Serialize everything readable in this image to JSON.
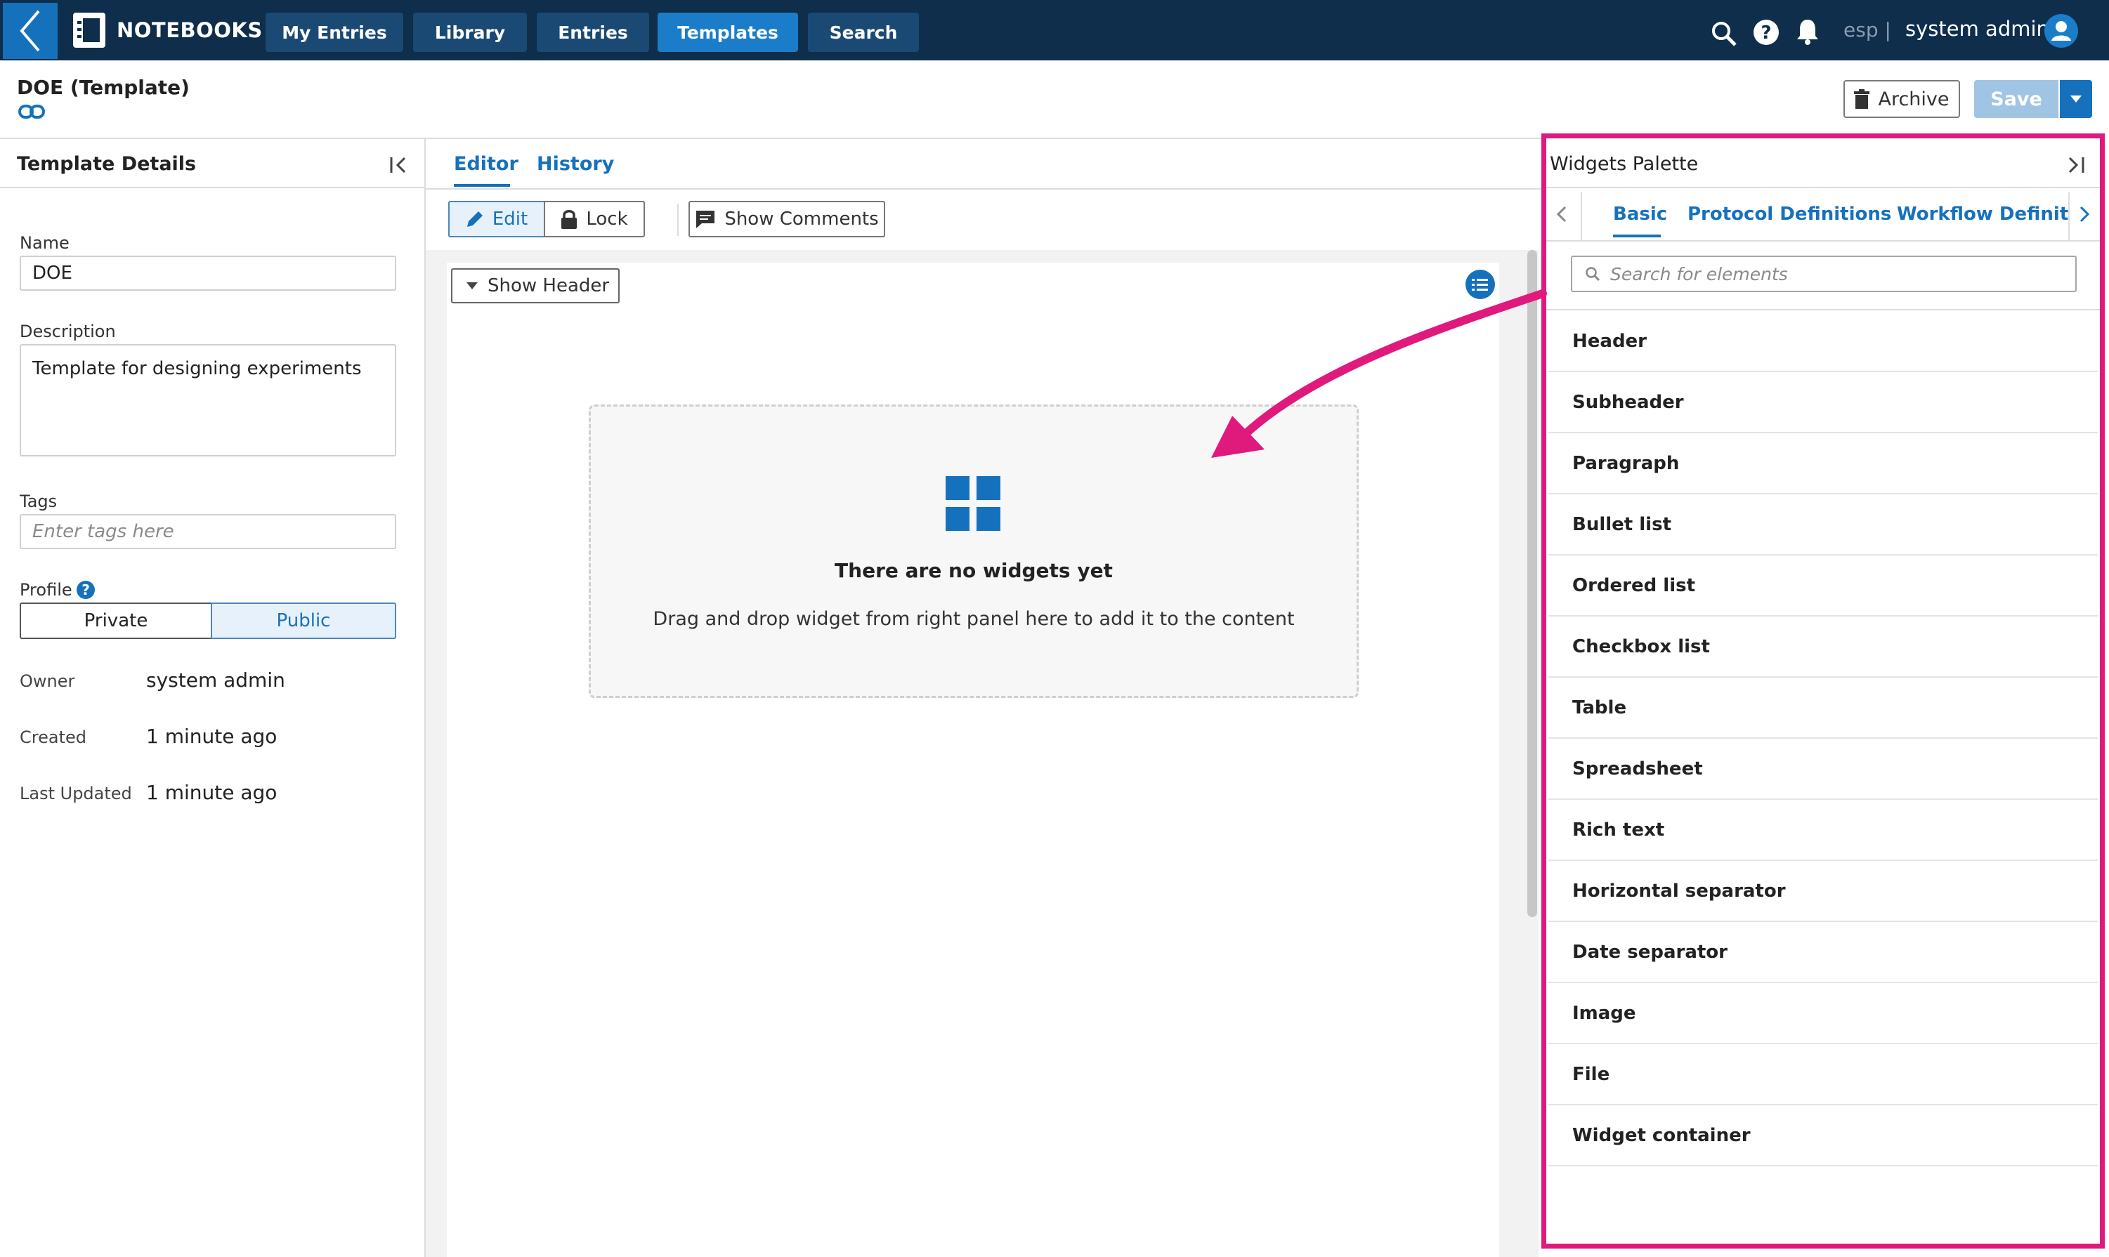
{
  "app": {
    "brand": "NOTEBOOKS",
    "nav": [
      "My Entries",
      "Library",
      "Entries",
      "Templates",
      "Search"
    ],
    "active_nav": "Templates",
    "lang": "esp |",
    "user_name": "system admin"
  },
  "page": {
    "title": "DOE (Template)",
    "archive_label": "Archive",
    "save_label": "Save"
  },
  "details": {
    "heading": "Template Details",
    "name_label": "Name",
    "name_value": "DOE",
    "description_label": "Description",
    "description_value": "Template for designing experiments",
    "tags_label": "Tags",
    "tags_placeholder": "Enter tags here",
    "profile_label": "Profile",
    "profile_options": [
      "Private",
      "Public"
    ],
    "profile_selected": "Public",
    "owner_label": "Owner",
    "owner_value": "system admin",
    "created_label": "Created",
    "created_value": "1 minute ago",
    "updated_label": "Last Updated",
    "updated_value": "1 minute ago"
  },
  "editor": {
    "tabs": [
      "Editor",
      "History"
    ],
    "active_tab": "Editor",
    "edit_label": "Edit",
    "lock_label": "Lock",
    "comments_label": "Show Comments",
    "show_header_label": "Show Header",
    "empty_title": "There are no widgets yet",
    "empty_text": "Drag and drop widget from right panel here to add it to the content"
  },
  "palette": {
    "heading": "Widgets Palette",
    "tabs": [
      "Basic",
      "Protocol Definitions",
      "Workflow Definitio"
    ],
    "active_tab": "Basic",
    "search_placeholder": "Search for elements",
    "items": [
      "Header",
      "Subheader",
      "Paragraph",
      "Bullet list",
      "Ordered list",
      "Checkbox list",
      "Table",
      "Spreadsheet",
      "Rich text",
      "Horizontal separator",
      "Date separator",
      "Image",
      "File",
      "Widget container"
    ]
  },
  "colors": {
    "nav_bg": "#0e2e4b",
    "accent": "#1671bd",
    "highlight": "#e0197d"
  }
}
